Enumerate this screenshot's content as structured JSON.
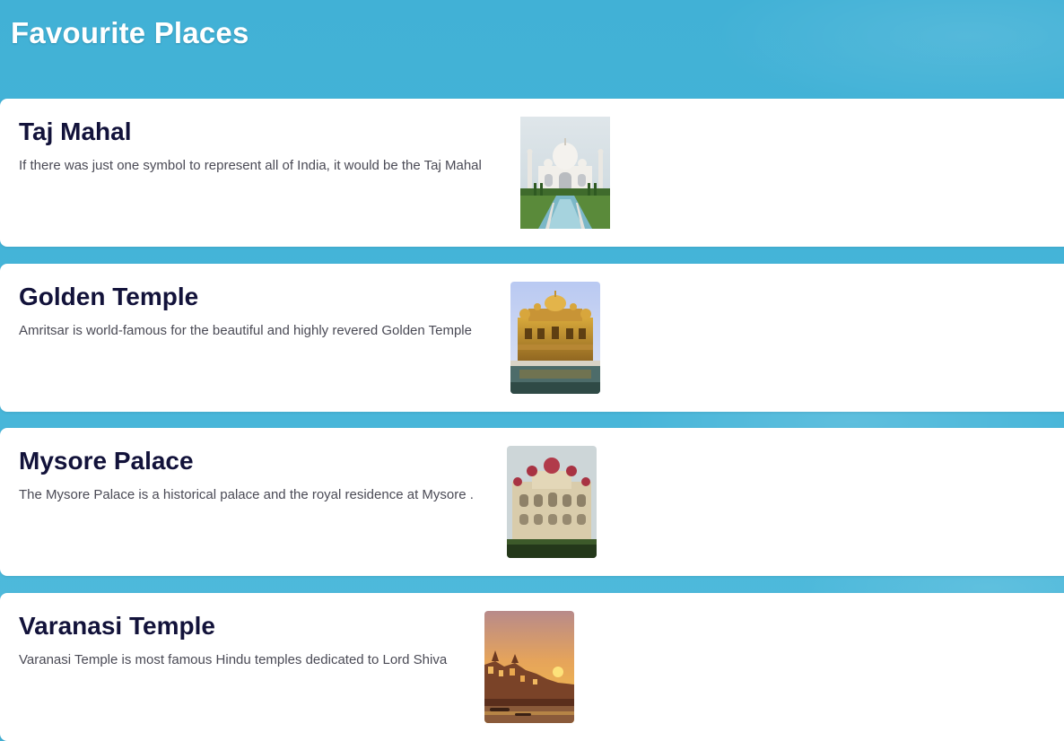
{
  "page": {
    "title": "Favourite Places"
  },
  "places": [
    {
      "name": "Taj Mahal",
      "description": "If there was just one symbol to represent all of India, it would be the Taj Mahal",
      "image_subject": "taj-mahal-photo"
    },
    {
      "name": "Golden Temple",
      "description": "Amritsar is world-famous for the beautiful and highly revered Golden Temple",
      "image_subject": "golden-temple-photo"
    },
    {
      "name": "Mysore Palace",
      "description": "The Mysore Palace is a historical palace and the royal residence at Mysore .",
      "image_subject": "mysore-palace-photo"
    },
    {
      "name": "Varanasi Temple",
      "description": "Varanasi Temple is most famous Hindu temples dedicated to Lord Shiva",
      "image_subject": "varanasi-ghats-photo"
    }
  ],
  "colors": {
    "background": "#45b4d8",
    "card": "#ffffff",
    "title_text": "#12123a",
    "body_text": "#4a4a55"
  }
}
